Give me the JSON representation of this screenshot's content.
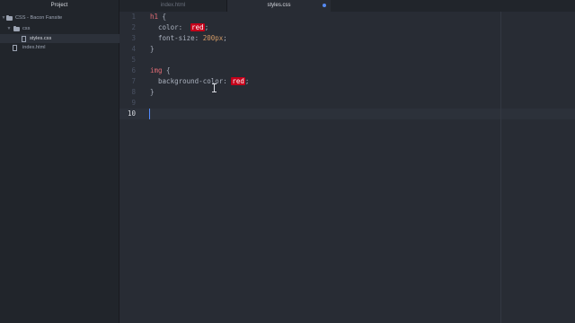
{
  "tabs": {
    "project": "Project",
    "index": "index.html",
    "styles": "styles.css"
  },
  "tree": {
    "root": "CSS - Bacon Fansite",
    "folder_css": "css",
    "file_styles": "styles.css",
    "file_index": "index.html"
  },
  "gutter": {
    "lines": [
      "1",
      "2",
      "3",
      "4",
      "5",
      "6",
      "7",
      "8",
      "9",
      "10"
    ]
  },
  "code": {
    "l1_selector": "h1",
    "l1_brace": " {",
    "l2_prop": "  color:  ",
    "l2_value": "red",
    "l2_semi": ";",
    "l3_prop": "  font-size: ",
    "l3_value": "200px",
    "l3_semi": ";",
    "l4_brace": "}",
    "l6_selector": "img",
    "l6_brace": " {",
    "l7_prop": "  background-color: ",
    "l7_value": "red",
    "l7_semi": ";",
    "l8_brace": "}"
  },
  "colors": {
    "accent": "#528bff",
    "highlight_red": "#c4001a",
    "selector": "#e06c75",
    "number": "#d19a66"
  }
}
